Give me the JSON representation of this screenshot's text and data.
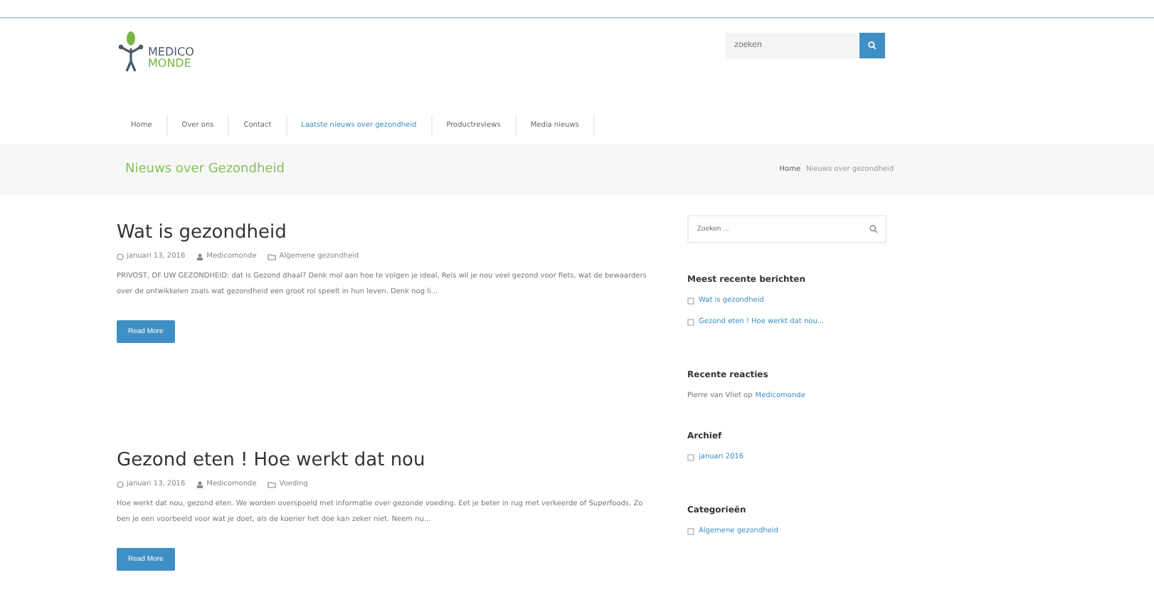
{
  "header": {
    "logo": {
      "line_1": "MEDICO",
      "line_2": "MONDE"
    },
    "search": {
      "placeholder": "zoeken"
    }
  },
  "nav": [
    {
      "label": "Home",
      "selected": false
    },
    {
      "label": "Over ons",
      "selected": false
    },
    {
      "label": "Contact",
      "selected": false
    },
    {
      "label": "Laatste nieuws over gezondheid",
      "selected": true
    },
    {
      "label": "Productreviews",
      "selected": false
    },
    {
      "label": "Media nieuws",
      "selected": false
    }
  ],
  "page_title": "Nieuws over Gezondheid",
  "breadcrumb": [
    "Home",
    "Nieuws over gezondheid"
  ],
  "posts": [
    {
      "title": "Wat is gezondheid",
      "date": "januari 13, 2016",
      "author": "Medicomonde",
      "category": "Algemene gezondheid",
      "excerpt": "PRIVOST, OF UW GEZONDHEID: dat is Gezond dhaal? Denk mol aan hoe te volgen je ideal, Reis wil je nou veel gezond voor fiets, wat de bewaarders over de ontwikkelen zoals wat gezondheid een groot rol speelt in hun leven. Denk nog li...",
      "button": "Read More"
    },
    {
      "title": "Gezond eten ! Hoe werkt dat nou",
      "date": "januari 13, 2016",
      "author": "Medicomonde",
      "category": "Voeding",
      "excerpt": "Hoe werkt dat nou, gezond eten. We worden overspoeld met informatie over gezonde voeding. Eet je beter in rug met verkeerde of Superfoods. Zo ben je een voorbeeld voor wat je doet, als de koerier het doe kan zeker niet. Neem nu...",
      "button": "Read More"
    }
  ],
  "sidebar": {
    "search": {
      "placeholder": "Zoeken ..."
    },
    "recent_posts": {
      "title": "Meest recente berichten",
      "items": [
        "Wat is gezondheid",
        "Gezond eten ! Hoe werkt dat nou..."
      ]
    },
    "recent_comments": {
      "title": "Recente reacties",
      "prefix": "Pierre van Vliet op",
      "link": "Medicomonde"
    },
    "archive": {
      "title": "Archief",
      "items": [
        "januari 2016"
      ]
    },
    "categories": {
      "title": "Categorieën",
      "items": [
        "Algemene gezondheid"
      ]
    }
  }
}
